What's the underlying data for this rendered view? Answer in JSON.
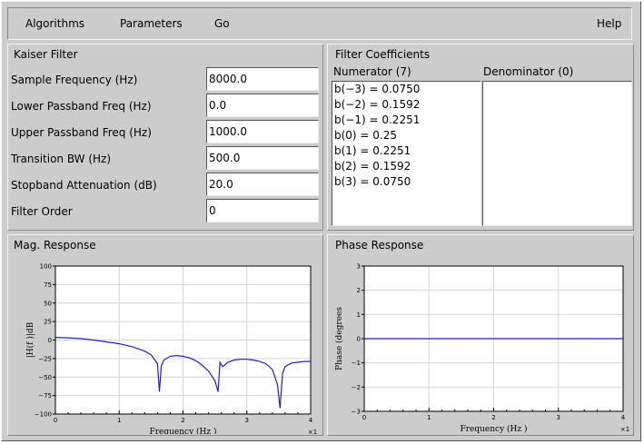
{
  "menu": {
    "algorithms": "Algorithms",
    "parameters": "Parameters",
    "go": "Go",
    "help": "Help"
  },
  "kaiser": {
    "title": "Kaiser Filter",
    "fields": [
      {
        "label": "Sample Frequency (Hz)",
        "value": "8000.0"
      },
      {
        "label": "Lower Passband Freq (Hz)",
        "value": "0.0"
      },
      {
        "label": "Upper Passband Freq (Hz)",
        "value": "1000.0"
      },
      {
        "label": "Transition BW (Hz)",
        "value": "500.0"
      },
      {
        "label": "Stopband Attenuation (dB)",
        "value": "20.0"
      },
      {
        "label": "Filter Order",
        "value": "0"
      }
    ]
  },
  "coefficients": {
    "title": "Filter Coefficients",
    "numerator_label": "Numerator (7)",
    "denominator_label": "Denominator (0)",
    "numerator": [
      "b(−3) = 0.0750",
      "b(−2) = 0.1592",
      "b(−1) = 0.2251",
      "b(0) = 0.25",
      "b(1) = 0.2251",
      "b(2) = 0.1592",
      "b(3) = 0.0750"
    ],
    "denominator": []
  },
  "mag_panel_title": "Mag. Response",
  "phase_panel_title": "Phase Response",
  "colors": {
    "curve": "#1f1fbf",
    "grid": "#d4d4d4",
    "plot_bg": "#ffffff",
    "window_bg": "#cccccc"
  },
  "chart_data": [
    {
      "type": "line",
      "title": "",
      "xlabel": "Frequency (Hz )",
      "ylabel": "|H(f )|dB",
      "xlim": [
        0,
        4
      ],
      "ylim": [
        -100,
        100
      ],
      "x_multiplier": "×1",
      "x_ticks": [
        "0",
        "1",
        "2",
        "3",
        "4"
      ],
      "y_ticks": [
        "100",
        "75",
        "50",
        "25",
        "0",
        "−25",
        "−50",
        "−75",
        "−100"
      ],
      "grid": true,
      "series": [
        {
          "x": [
            0,
            0.2,
            0.4,
            0.6,
            0.8,
            1.0,
            1.2,
            1.4,
            1.5,
            1.6,
            1.63,
            1.66,
            1.7,
            1.8,
            1.9,
            2.0,
            2.1,
            2.2,
            2.3,
            2.4,
            2.5,
            2.55,
            2.58,
            2.62,
            2.7,
            2.8,
            2.9,
            3.0,
            3.1,
            3.2,
            3.3,
            3.4,
            3.48,
            3.52,
            3.56,
            3.6,
            3.7,
            3.8,
            3.9,
            4.0
          ],
          "y": [
            3.5,
            3,
            2,
            0,
            -2.5,
            -5,
            -9,
            -15,
            -20,
            -32,
            -70,
            -35,
            -27,
            -22,
            -21,
            -22,
            -24,
            -28,
            -34,
            -42,
            -55,
            -70,
            -30,
            -36,
            -30,
            -27,
            -26,
            -26,
            -27,
            -29,
            -32,
            -40,
            -60,
            -92,
            -45,
            -36,
            -31,
            -30,
            -29,
            -29
          ]
        }
      ]
    },
    {
      "type": "line",
      "title": "",
      "xlabel": "Frequency (Hz )",
      "ylabel": "Phase (degrees",
      "xlim": [
        0,
        4
      ],
      "ylim": [
        -3,
        3
      ],
      "x_multiplier": "×1",
      "x_ticks": [
        "0",
        "1",
        "2",
        "3",
        "4"
      ],
      "y_ticks": [
        "3",
        "2",
        "1",
        "0",
        "−1",
        "−2",
        "−3"
      ],
      "grid": true,
      "series": [
        {
          "x": [
            0,
            4
          ],
          "y": [
            0,
            0
          ]
        }
      ]
    }
  ]
}
